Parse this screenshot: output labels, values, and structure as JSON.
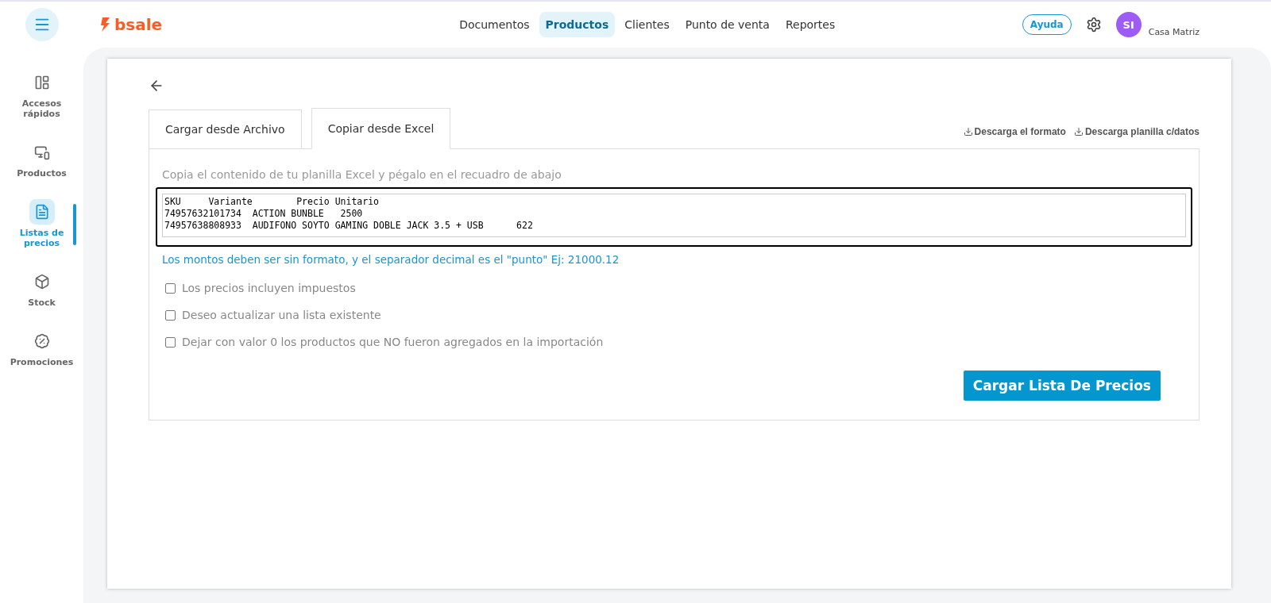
{
  "header": {
    "logo": "bsale",
    "nav": [
      {
        "label": "Documentos",
        "selected": false
      },
      {
        "label": "Productos",
        "selected": true
      },
      {
        "label": "Clientes",
        "selected": false
      },
      {
        "label": "Punto de venta",
        "selected": false
      },
      {
        "label": "Reportes",
        "selected": false
      }
    ],
    "help": "Ayuda",
    "avatar": "SI",
    "branch": "Casa Matriz"
  },
  "sidebar": {
    "items": [
      {
        "kind": "layout",
        "label": "Accesos rápidos",
        "selected": false
      },
      {
        "kind": "products",
        "label": "Productos",
        "selected": false
      },
      {
        "kind": "pricelist",
        "label": "Listas de precios",
        "selected": true
      },
      {
        "kind": "stock",
        "label": "Stock",
        "selected": false
      },
      {
        "kind": "promo",
        "label": "Promociones",
        "selected": false
      }
    ]
  },
  "tabs": [
    {
      "label": "Cargar desde Archivo",
      "selected": false
    },
    {
      "label": "Copiar desde Excel",
      "selected": true
    }
  ],
  "downloads": [
    "Descarga el formato",
    "Descarga planilla c/datos"
  ],
  "instruction": "Copia el contenido de tu planilla Excel y pégalo en el recuadro de abajo",
  "paste_value": [
    "SKU     Variante        Precio Unitario",
    "74957632101734  ACTION BUNBLE   2500",
    "74957638808933  AUDIFONO SOYTO GAMING DOBLE JACK 3.5 + USB      622"
  ],
  "note": "Los montos deben ser sin formato, y el separador decimal es el \"punto\" Ej: 21000.12",
  "options": [
    {
      "label": "Los precios incluyen impuestos",
      "checked": false
    },
    {
      "label": "Deseo actualizar una lista existente",
      "checked": false
    },
    {
      "label": "Dejar con valor 0 los productos que NO fueron agregados en la importación",
      "checked": false
    }
  ],
  "submit": "Cargar Lista De Precios"
}
